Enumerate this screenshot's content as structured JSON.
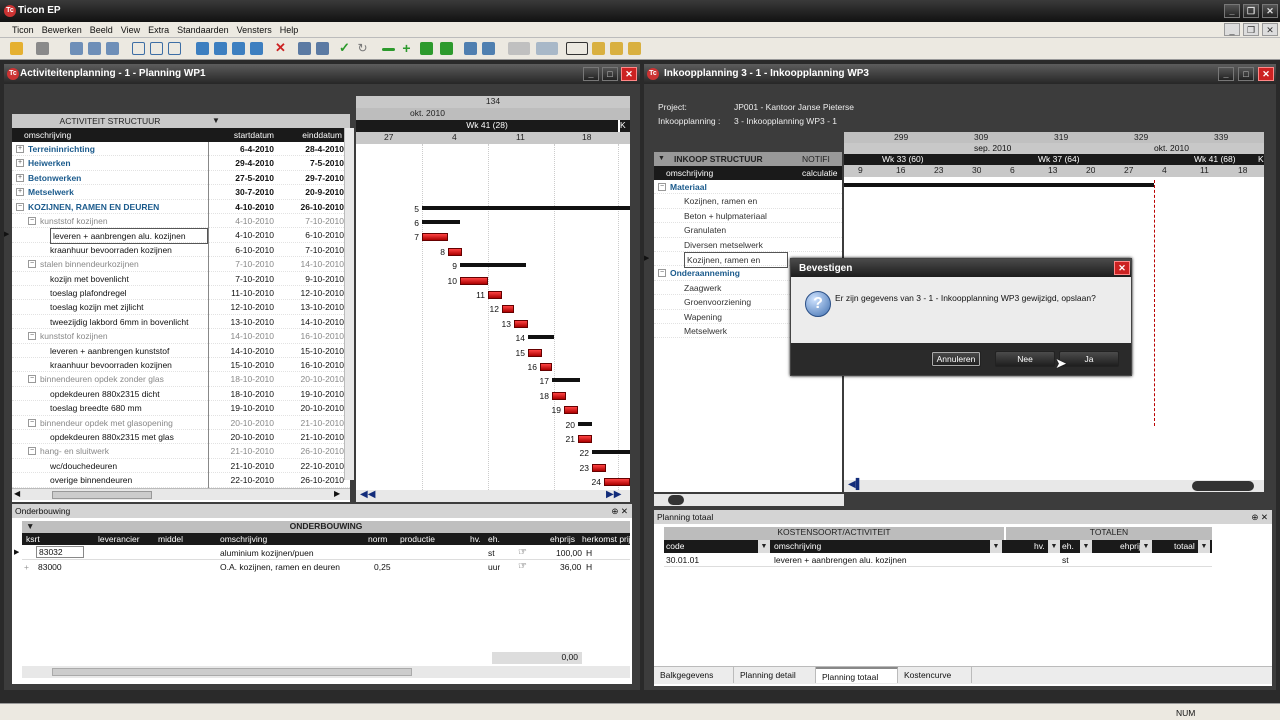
{
  "app": {
    "title": "Ticon EP",
    "logo": "Tc"
  },
  "menu": [
    "Ticon",
    "Bewerken",
    "Beeld",
    "View",
    "Extra",
    "Standaarden",
    "Vensters",
    "Help"
  ],
  "left": {
    "title": "Activiteitenplanning  - 1 - Planning WP1",
    "structure_header": "ACTIVITEIT STRUCTUUR",
    "cols": {
      "desc": "omschrijving",
      "start": "startdatum",
      "end": "einddatum"
    },
    "rows": [
      {
        "l": 0,
        "exp": "+",
        "name": "Terreininrichting",
        "s": "6-4-2010",
        "e": "28-4-2010",
        "st": "b"
      },
      {
        "l": 0,
        "exp": "+",
        "name": "Heiwerken",
        "s": "29-4-2010",
        "e": "7-5-2010",
        "st": "b"
      },
      {
        "l": 0,
        "exp": "+",
        "name": "Betonwerken",
        "s": "27-5-2010",
        "e": "29-7-2010",
        "st": "b"
      },
      {
        "l": 0,
        "exp": "+",
        "name": "Metselwerk",
        "s": "30-7-2010",
        "e": "20-9-2010",
        "st": "b"
      },
      {
        "l": 0,
        "exp": "−",
        "name": "KOZIJNEN, RAMEN EN DEUREN",
        "s": "4-10-2010",
        "e": "26-10-2010",
        "st": "b"
      },
      {
        "l": 1,
        "exp": "−",
        "name": "kunststof kozijnen",
        "s": "4-10-2010",
        "e": "7-10-2010",
        "st": "g"
      },
      {
        "l": 2,
        "exp": "",
        "name": "leveren + aanbrengen alu. kozijnen",
        "s": "4-10-2010",
        "e": "6-10-2010",
        "st": "sel"
      },
      {
        "l": 2,
        "exp": "",
        "name": "kraanhuur bevoorraden kozijnen",
        "s": "6-10-2010",
        "e": "7-10-2010",
        "st": "n"
      },
      {
        "l": 1,
        "exp": "−",
        "name": "stalen binnendeurkozijnen",
        "s": "7-10-2010",
        "e": "14-10-2010",
        "st": "g"
      },
      {
        "l": 2,
        "exp": "",
        "name": "kozijn met bovenlicht",
        "s": "7-10-2010",
        "e": "9-10-2010",
        "st": "n"
      },
      {
        "l": 2,
        "exp": "",
        "name": "toeslag plafondregel",
        "s": "11-10-2010",
        "e": "12-10-2010",
        "st": "n"
      },
      {
        "l": 2,
        "exp": "",
        "name": "toeslag kozijn met zijlicht",
        "s": "12-10-2010",
        "e": "13-10-2010",
        "st": "n"
      },
      {
        "l": 2,
        "exp": "",
        "name": "tweezijdig lakbord 6mm in bovenlicht",
        "s": "13-10-2010",
        "e": "14-10-2010",
        "st": "n"
      },
      {
        "l": 1,
        "exp": "−",
        "name": "kunststof kozijnen",
        "s": "14-10-2010",
        "e": "16-10-2010",
        "st": "g"
      },
      {
        "l": 2,
        "exp": "",
        "name": "leveren + aanbrengen kunststof",
        "s": "14-10-2010",
        "e": "15-10-2010",
        "st": "n"
      },
      {
        "l": 2,
        "exp": "",
        "name": "kraanhuur bevoorraden kozijnen",
        "s": "15-10-2010",
        "e": "16-10-2010",
        "st": "n"
      },
      {
        "l": 1,
        "exp": "−",
        "name": "binnendeuren opdek zonder glas",
        "s": "18-10-2010",
        "e": "20-10-2010",
        "st": "g"
      },
      {
        "l": 2,
        "exp": "",
        "name": "opdekdeuren 880x2315 dicht",
        "s": "18-10-2010",
        "e": "19-10-2010",
        "st": "n"
      },
      {
        "l": 2,
        "exp": "",
        "name": "toeslag breedte 680 mm",
        "s": "19-10-2010",
        "e": "20-10-2010",
        "st": "n"
      },
      {
        "l": 1,
        "exp": "−",
        "name": "binnendeur opdek met glasopening",
        "s": "20-10-2010",
        "e": "21-10-2010",
        "st": "g"
      },
      {
        "l": 2,
        "exp": "",
        "name": "opdekdeuren 880x2315 met glas",
        "s": "20-10-2010",
        "e": "21-10-2010",
        "st": "n"
      },
      {
        "l": 1,
        "exp": "−",
        "name": "hang- en sluitwerk",
        "s": "21-10-2010",
        "e": "26-10-2010",
        "st": "g"
      },
      {
        "l": 2,
        "exp": "",
        "name": "wc/douchedeuren",
        "s": "21-10-2010",
        "e": "22-10-2010",
        "st": "n"
      },
      {
        "l": 2,
        "exp": "",
        "name": "overige binnendeuren",
        "s": "22-10-2010",
        "e": "26-10-2010",
        "st": "n"
      }
    ],
    "gantt": {
      "week_num": "134",
      "month": "okt. 2010",
      "week": "Wk 41 (28)",
      "week_k": "K",
      "days": [
        "27",
        "4",
        "11",
        "18"
      ],
      "labels": [
        "5",
        "6",
        "7",
        "8",
        "9",
        "10",
        "11",
        "12",
        "13",
        "14",
        "15",
        "16",
        "17",
        "18",
        "19",
        "20",
        "21",
        "22",
        "23",
        "24"
      ]
    }
  },
  "onder": {
    "title": "Onderbouwing",
    "header": "ONDERBOUWING",
    "cols": [
      "ksrt",
      "leverancier",
      "middel",
      "omschrijving",
      "norm",
      "productie",
      "hv.",
      "eh.",
      "ehprijs",
      "herkomst prij"
    ],
    "rows": [
      {
        "ksrt": "83032",
        "oms": "aluminium kozijnen/puen",
        "norm": "",
        "eh": "st",
        "ehprijs": "100,00",
        "h": "H"
      },
      {
        "ksrt": "83000",
        "oms": "O.A. kozijnen, ramen en deuren",
        "norm": "0,25",
        "eh": "uur",
        "ehprijs": "36,00",
        "h": "H"
      }
    ],
    "total": "0,00"
  },
  "right": {
    "title": "Inkoopplanning 3 - 1 - Inkoopplanning WP3",
    "project_label": "Project:",
    "project_value": "JP001 - Kantoor Janse  Pieterse",
    "ink_label": "Inkoopplanning :",
    "ink_value": "3 - Inkoopplanning WP3 - 1",
    "structure_header": "INKOOP STRUCTUUR",
    "col_desc": "omschrijving",
    "col_notif": "NOTIFI",
    "col_calc": "calculatie",
    "rows": [
      {
        "name": "Materiaal",
        "st": "b",
        "l": 0
      },
      {
        "name": "Kozijnen, ramen en",
        "st": "n",
        "l": 1
      },
      {
        "name": "Beton + hulpmateriaal",
        "st": "n",
        "l": 1
      },
      {
        "name": "Granulaten",
        "st": "n",
        "l": 1
      },
      {
        "name": "Diversen metselwerk",
        "st": "n",
        "l": 1
      },
      {
        "name": "Kozijnen, ramen en",
        "st": "sel",
        "l": 1
      },
      {
        "name": "Onderaanneming",
        "st": "b",
        "l": 0
      },
      {
        "name": "Zaagwerk",
        "st": "n",
        "l": 1
      },
      {
        "name": "Groenvoorziening",
        "st": "n",
        "l": 1
      },
      {
        "name": "Wapening",
        "st": "n",
        "l": 1
      },
      {
        "name": "Metselwerk",
        "st": "n",
        "l": 1
      }
    ],
    "gantt": {
      "nums": [
        "299",
        "309",
        "319",
        "329",
        "339"
      ],
      "months": [
        "sep. 2010",
        "okt. 2010"
      ],
      "weeks": [
        "Wk 33 (60)",
        "Wk 37 (64)",
        "Wk 41 (68)",
        "K"
      ],
      "days": [
        "9",
        "16",
        "23",
        "30",
        "6",
        "13",
        "20",
        "27",
        "4",
        "11",
        "18"
      ]
    }
  },
  "planning_totaal": {
    "title": "Planning totaal",
    "h1": "KOSTENSOORT/ACTIVITEIT",
    "h2": "TOTALEN",
    "cols": [
      "code",
      "omschrijving",
      "hv.",
      "eh.",
      "ehprijs",
      "totaal"
    ],
    "row": {
      "code": "30.01.01",
      "oms": "leveren + aanbrengen alu. kozijnen",
      "eh": "st"
    },
    "tabs": [
      "Balkgegevens",
      "Planning detail",
      "Planning totaal",
      "Kostencurve"
    ]
  },
  "dialog": {
    "title": "Bevestigen",
    "message": "Er zijn gegevens van 3 - 1 - Inkoopplanning WP3 gewijzigd, opslaan?",
    "btn_cancel": "Annuleren",
    "btn_no": "Nee",
    "btn_yes": "Ja"
  },
  "status": {
    "num": "NUM"
  },
  "colors": {
    "accent": "#1a5a8c",
    "bar_red": "#cc1122",
    "close_red": "#cc2222"
  }
}
